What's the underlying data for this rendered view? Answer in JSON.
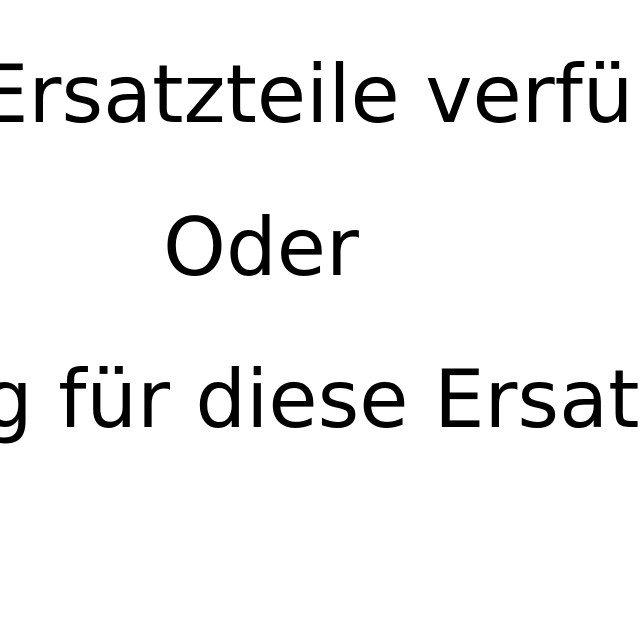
{
  "lines": [
    "Ersatzteile verfü",
    "Oder",
    "g für diese Ersat"
  ]
}
